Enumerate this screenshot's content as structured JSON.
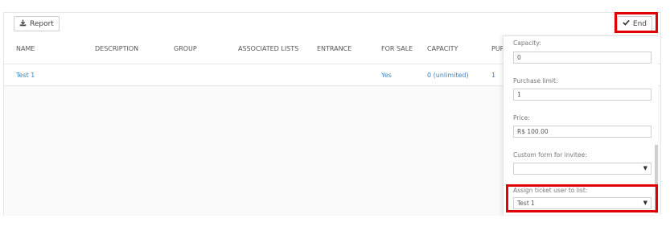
{
  "toolbar": {
    "report_label": "Report",
    "report_icon": "download-icon",
    "end_label": "End",
    "end_icon": "check-icon"
  },
  "table": {
    "headers": [
      "NAME",
      "DESCRIPTION",
      "GROUP",
      "ASSOCIATED LISTS",
      "ENTRANCE",
      "FOR SALE",
      "CAPACITY",
      "PUR"
    ],
    "rows": [
      {
        "name": "Test 1",
        "for_sale": "Yes",
        "capacity": "0 (unlimited)",
        "purchase": "1"
      }
    ]
  },
  "form": {
    "capacity_label": "Capacity:",
    "capacity_value": "0",
    "purchase_limit_label": "Purchase limit:",
    "purchase_limit_value": "1",
    "price_label": "Price:",
    "price_value": "R$ 100.00",
    "custom_form_label": "Custom form for invitee:",
    "custom_form_value": "",
    "assign_label": "Assign ticket user to list:",
    "assign_value": "Test 1"
  },
  "colors": {
    "highlight": "#e00000",
    "link": "#3b82c4"
  }
}
